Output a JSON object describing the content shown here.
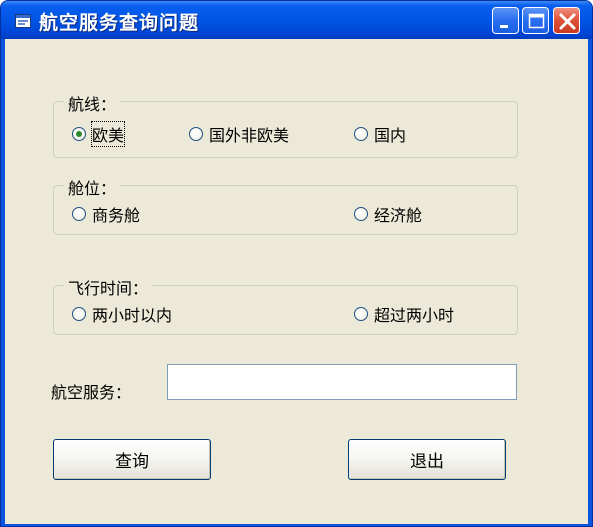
{
  "window": {
    "title": "航空服务查询问题",
    "icon": "app-window-icon",
    "controls": [
      "minimize-icon",
      "maximize-icon",
      "close-icon"
    ],
    "title_color": "#0055e5"
  },
  "route": {
    "label": "航线：",
    "options": [
      {
        "label": "欧美",
        "checked": true
      },
      {
        "label": "国外非欧美",
        "checked": false
      },
      {
        "label": "国内",
        "checked": false
      }
    ]
  },
  "cabin": {
    "label": "舱位：",
    "options": [
      {
        "label": "商务舱",
        "checked": false
      },
      {
        "label": "经济舱",
        "checked": false
      }
    ]
  },
  "flight_time": {
    "label": "飞行时间：",
    "options": [
      {
        "label": "两小时以内",
        "checked": false
      },
      {
        "label": "超过两小时",
        "checked": false
      }
    ]
  },
  "service": {
    "label": "航空服务：",
    "value": ""
  },
  "buttons": {
    "query": "查询",
    "exit": "退出"
  },
  "colors": {
    "face": "#ece9d8",
    "radio_dot": "#2a8a2a",
    "close_button": "#e0553a"
  }
}
